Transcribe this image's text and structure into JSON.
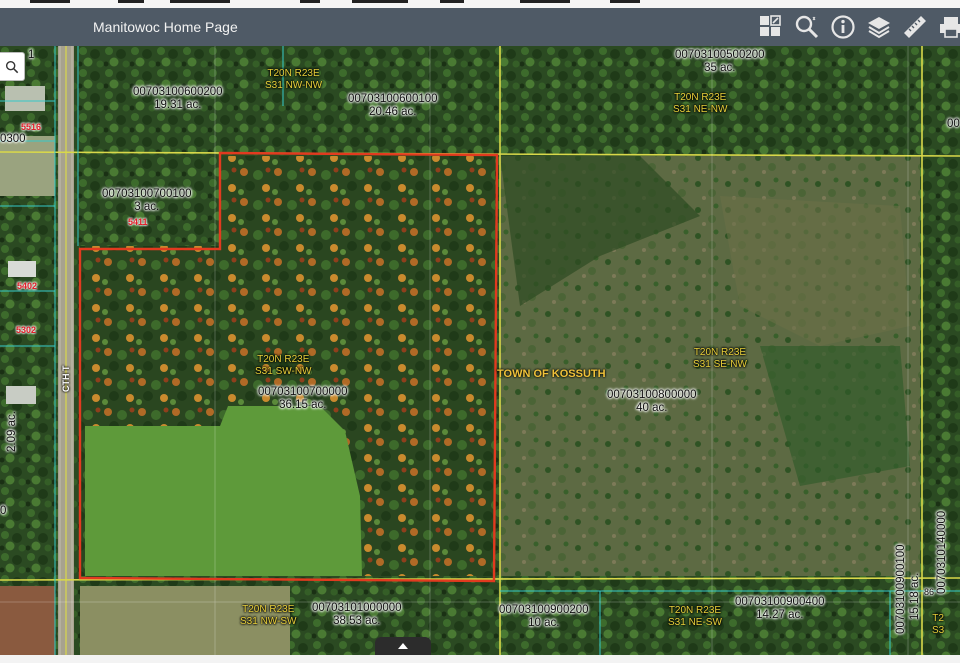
{
  "app": {
    "title": "Manitowoc Home Page"
  },
  "toolbar": [
    {
      "name": "basemap-gallery-icon",
      "label": "Basemap Gallery"
    },
    {
      "name": "search-tool-icon",
      "label": "Search"
    },
    {
      "name": "info-icon",
      "label": "About"
    },
    {
      "name": "layers-icon",
      "label": "Layers"
    },
    {
      "name": "measure-icon",
      "label": "Measure"
    },
    {
      "name": "print-icon",
      "label": "Print"
    }
  ],
  "map": {
    "search_icon": "search-icon",
    "collapse_icon": "chevron-up-icon",
    "town_label": "TOWN OF KOSSUTH",
    "road_label": "CTH T",
    "colors": {
      "selected_parcel": "#e23a1f",
      "section_line": "#d9d84a",
      "parcel_line": "#35c9c9",
      "trs_text": "#e8cf3a",
      "address_text": "#e0202a"
    },
    "parcels": [
      {
        "id": "00703100600200",
        "acres": "19.31 ac."
      },
      {
        "id": "00703100600100",
        "acres": "20.46 ac."
      },
      {
        "id": "00703100500200",
        "acres": "35 ac."
      },
      {
        "id": "00703100700100",
        "acres": "3 ac."
      },
      {
        "id": "00703100700000",
        "acres": "36.15 ac."
      },
      {
        "id": "00703100800000",
        "acres": "40 ac."
      },
      {
        "id": "00703101000000",
        "acres": "38.53 ac."
      },
      {
        "id": "00703100900200",
        "acres": "10 ac."
      },
      {
        "id": "00703100900400",
        "acres": "14.27 ac."
      },
      {
        "id": "00703100900100",
        "acres": "15.18 ac."
      },
      {
        "id": "0070310140000",
        "acres": ""
      }
    ],
    "edge_labels": {
      "top_left_id": "1",
      "left_mid_id": "0300",
      "left_vertical_acres": "2.09 ac.",
      "left_lower": "0",
      "right_top": "00",
      "right_lower_small": "86",
      "right_bottom_trs": "T2",
      "right_bottom_sec": "S3"
    },
    "trs_labels": [
      {
        "line1": "T20N R23E",
        "line2": "S31 NW-NW"
      },
      {
        "line1": "T20N R23E",
        "line2": "S31 NE-NW"
      },
      {
        "line1": "T20N R23E",
        "line2": "S31 SW-NW"
      },
      {
        "line1": "T20N R23E",
        "line2": "S31 SE-NW"
      },
      {
        "line1": "T20N R23E",
        "line2": "S31 NW-SW"
      },
      {
        "line1": "T20N R23E",
        "line2": "S31 NE-SW"
      }
    ],
    "addresses": [
      "5516",
      "5411",
      "5402",
      "5302"
    ]
  }
}
